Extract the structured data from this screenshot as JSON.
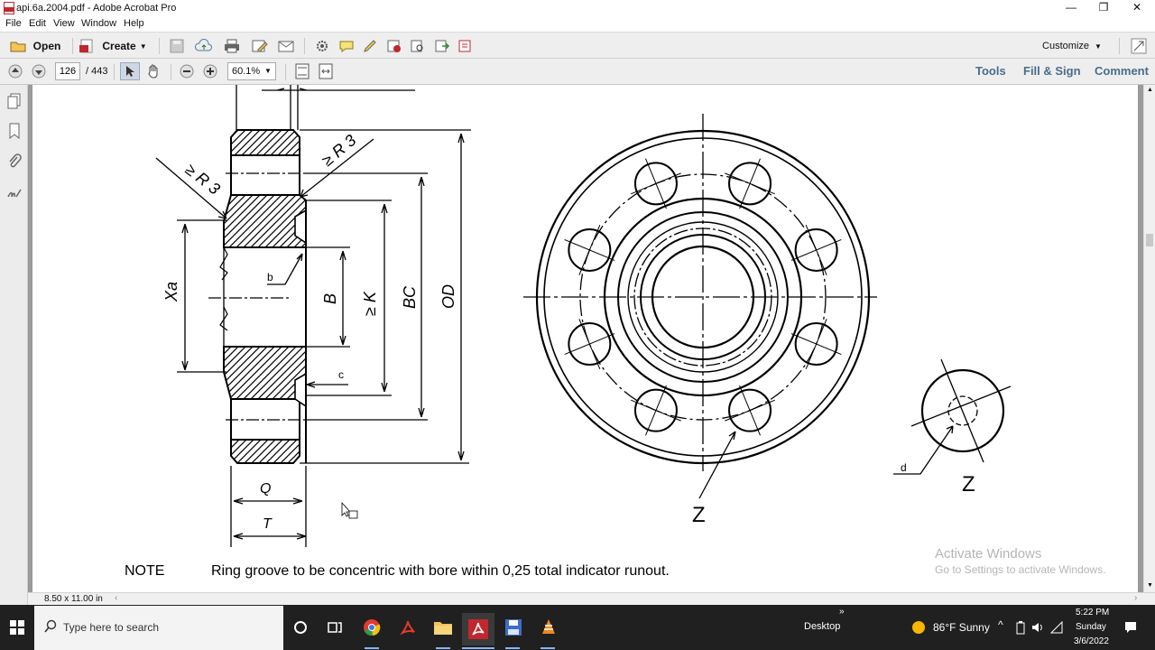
{
  "window": {
    "title": "api.6a.2004.pdf - Adobe Acrobat Pro",
    "controls": {
      "minimize": "—",
      "restore": "❐",
      "close": "✕"
    }
  },
  "menu": [
    "File",
    "Edit",
    "View",
    "Window",
    "Help"
  ],
  "toolbar": {
    "open_label": "Open",
    "create_label": "Create",
    "customize_label": "Customize"
  },
  "nav": {
    "page_current": "126",
    "page_total": "/ 443",
    "zoom": "60.1%",
    "tools_label": "Tools",
    "fillsign_label": "Fill & Sign",
    "comment_label": "Comment"
  },
  "drawing": {
    "labels": {
      "r3_left": "≥ R 3",
      "r3_right": "≥ R 3",
      "xa": "Xa",
      "b_small": "b",
      "b_big": "B",
      "k": "≥ K",
      "bc": "BC",
      "od": "OD",
      "c": "c",
      "q": "Q",
      "t": "T",
      "z_flange": "Z",
      "d": "d",
      "z_detail": "Z"
    },
    "note_label": "NOTE",
    "note_text": "Ring groove to be concentric with bore within 0,25 total indicator runout."
  },
  "watermark": {
    "title": "Activate Windows",
    "subtitle": "Go to Settings to activate Windows."
  },
  "status": {
    "page_size": "8.50 x 11.00 in"
  },
  "taskbar": {
    "search_placeholder": "Type here to search",
    "desktop_label": "Desktop",
    "weather": "86°F  Sunny",
    "time": "5:22 PM",
    "day": "Sunday",
    "date": "3/6/2022"
  },
  "colors": {
    "acrobat_red": "#c1272d",
    "pane_blue": "#4a6d8c",
    "taskbar": "#202020"
  }
}
